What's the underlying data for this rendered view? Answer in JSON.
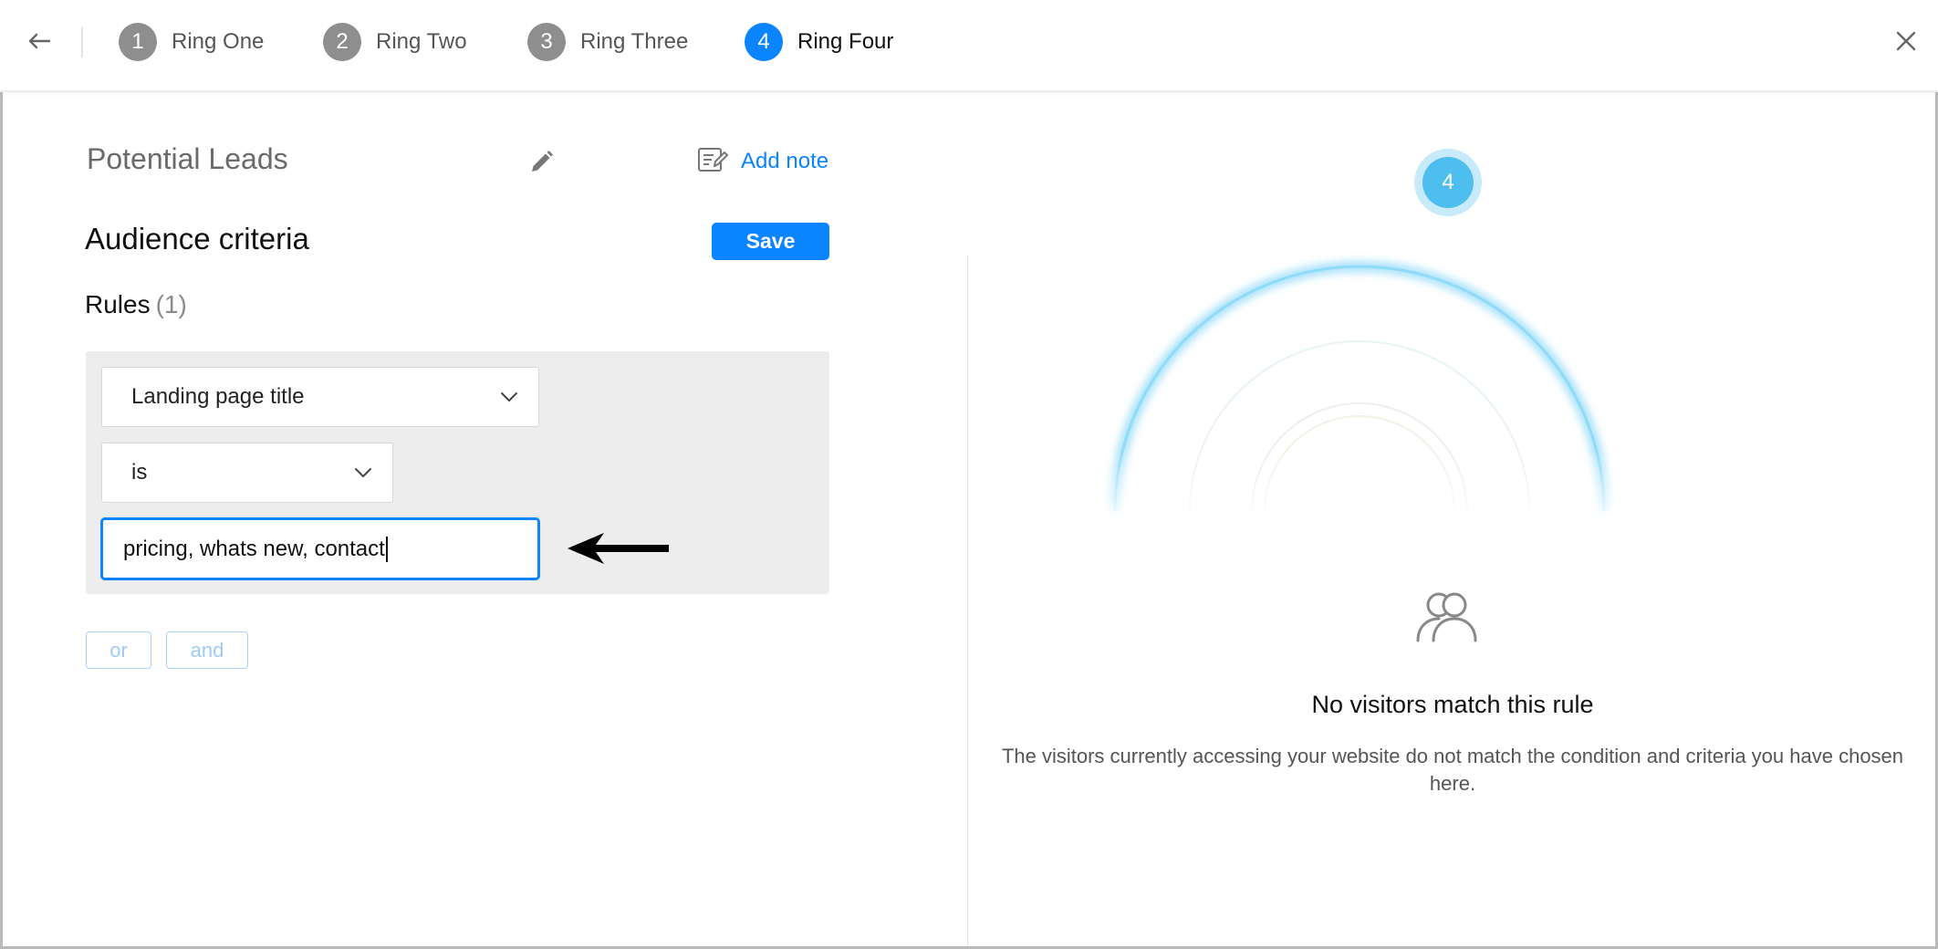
{
  "steps": [
    {
      "number": "1",
      "label": "Ring One"
    },
    {
      "number": "2",
      "label": "Ring Two"
    },
    {
      "number": "3",
      "label": "Ring Three"
    },
    {
      "number": "4",
      "label": "Ring Four"
    }
  ],
  "segment": {
    "title": "Potential Leads",
    "add_note_label": "Add note"
  },
  "criteria": {
    "title": "Audience criteria",
    "save_label": "Save",
    "rules_label": "Rules",
    "rules_count": "(1)",
    "rule": {
      "field": "Landing page title",
      "operator": "is",
      "value": "pricing, whats new, contact"
    },
    "or_label": "or",
    "and_label": "and"
  },
  "preview": {
    "ring_badge": "4",
    "empty_title": "No visitors match this rule",
    "empty_description": "The visitors currently accessing your website do not match the condition and criteria you have chosen here."
  },
  "colors": {
    "accent": "#0a84ff",
    "inactive_step": "#8e8e8e",
    "ring_badge": "#4dbeee"
  },
  "icons": [
    "back-arrow-icon",
    "close-icon",
    "pencil-icon",
    "note-icon",
    "chevron-down-icon",
    "left-arrow-indicator-icon",
    "users-icon"
  ]
}
